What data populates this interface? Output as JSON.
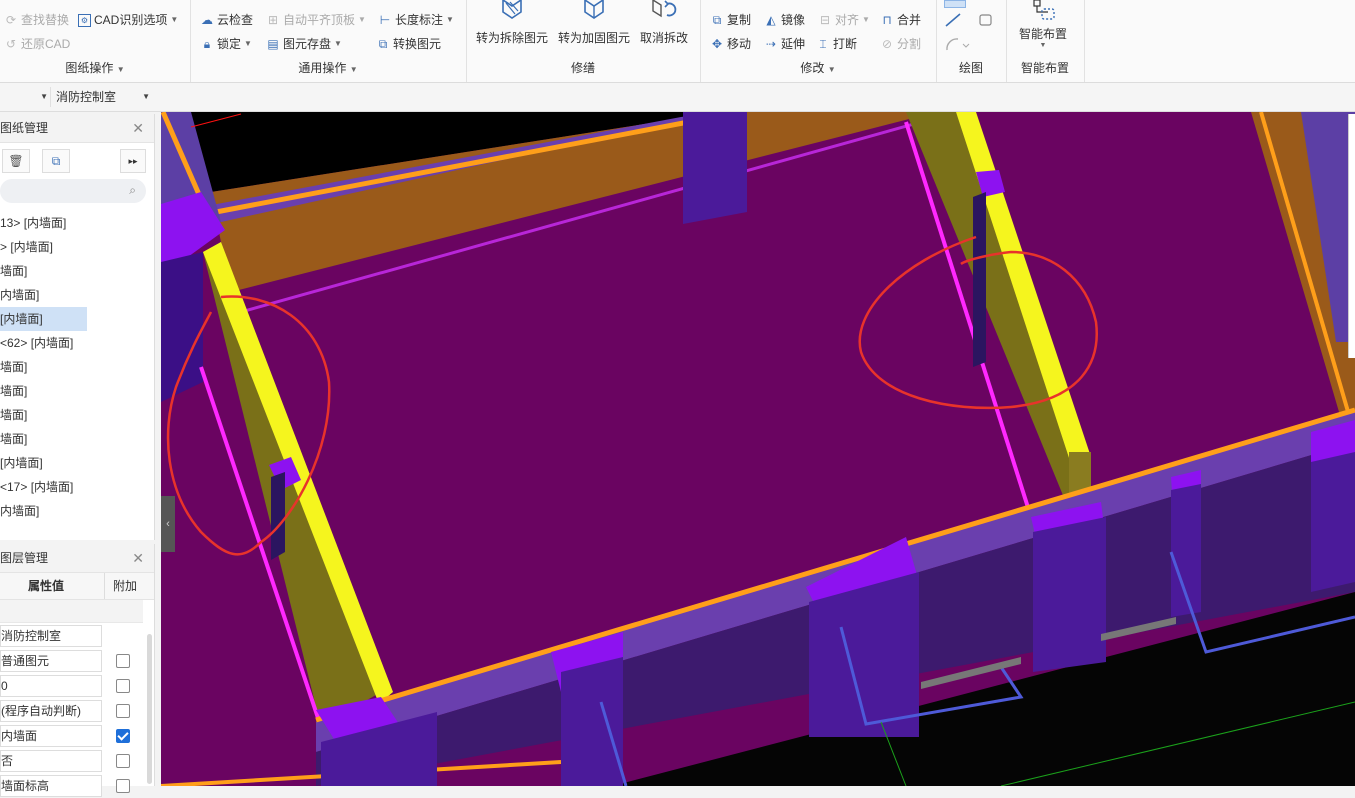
{
  "ribbon": {
    "drawing_ops": {
      "title": "图纸操作",
      "items": [
        {
          "label": "查找替换",
          "icon": "find-replace-icon",
          "disabled": true
        },
        {
          "label": "CAD识别选项",
          "icon": "cad-options-icon",
          "disabled": false
        },
        {
          "label": "还原CAD",
          "icon": "restore-cad-icon",
          "disabled": true
        }
      ]
    },
    "general_ops": {
      "title": "通用操作",
      "items": [
        {
          "label": "云检查",
          "icon": "cloud-check-icon",
          "disabled": false
        },
        {
          "label": "自动平齐顶板",
          "icon": "auto-align-icon",
          "disabled": true
        },
        {
          "label": "长度标注",
          "icon": "length-dim-icon",
          "disabled": false
        },
        {
          "label": "锁定",
          "icon": "lock-icon",
          "disabled": false
        },
        {
          "label": "图元存盘",
          "icon": "save-element-icon",
          "disabled": false
        },
        {
          "label": "转换图元",
          "icon": "convert-element-icon",
          "disabled": false
        }
      ]
    },
    "repair": {
      "title": "修缮",
      "items": [
        {
          "label": "转为拆除图元",
          "icon": "demolish-element-icon"
        },
        {
          "label": "转为加固图元",
          "icon": "reinforce-element-icon"
        },
        {
          "label": "取消拆改",
          "icon": "cancel-modify-icon"
        }
      ]
    },
    "modify": {
      "title": "修改",
      "items": [
        {
          "label": "复制",
          "icon": "copy-icon",
          "disabled": false
        },
        {
          "label": "镜像",
          "icon": "mirror-icon",
          "disabled": false
        },
        {
          "label": "对齐",
          "icon": "align-icon",
          "disabled": true
        },
        {
          "label": "合并",
          "icon": "merge-icon",
          "disabled": false
        },
        {
          "label": "移动",
          "icon": "move-icon",
          "disabled": false
        },
        {
          "label": "延伸",
          "icon": "extend-icon",
          "disabled": false
        },
        {
          "label": "打断",
          "icon": "break-icon",
          "disabled": false
        },
        {
          "label": "分割",
          "icon": "split-icon",
          "disabled": true
        }
      ]
    },
    "draw": {
      "title": "绘图"
    },
    "smart": {
      "title": "智能布置",
      "button_label": "智能布置"
    }
  },
  "toolbar2": {
    "layer_select": "消防控制室"
  },
  "drawing_panel": {
    "title": "图纸管理",
    "items": [
      "13> [内墙面]",
      "> [内墙面]",
      "墙面]",
      "内墙面]",
      "[内墙面]",
      "<62> [内墙面]",
      "墙面]",
      "墙面]",
      "墙面]",
      "墙面]",
      "[内墙面]",
      "<17> [内墙面]",
      "内墙面]"
    ],
    "selected_index": 4
  },
  "layer_panel": {
    "title": "图层管理",
    "col_value": "属性值",
    "col_extra": "附加",
    "rows": [
      {
        "value": "消防控制室",
        "checkbox": null
      },
      {
        "value": "普通图元",
        "checkbox": false
      },
      {
        "value": "0",
        "checkbox": false
      },
      {
        "value": "(程序自动判断)",
        "checkbox": false
      },
      {
        "value": "内墙面",
        "checkbox": true
      },
      {
        "value": "否",
        "checkbox": false
      },
      {
        "value": "墙面标高",
        "checkbox": false
      }
    ]
  },
  "colors": {
    "floor": "#6a0461",
    "wall_purple": "#5c3fa5",
    "column_violet": "#8d12f0",
    "edge_orange": "#ff9f1a",
    "beam_yellow": "#f5f51e",
    "beam_olive": "#7a7018",
    "annotation_red": "#e8332b"
  }
}
